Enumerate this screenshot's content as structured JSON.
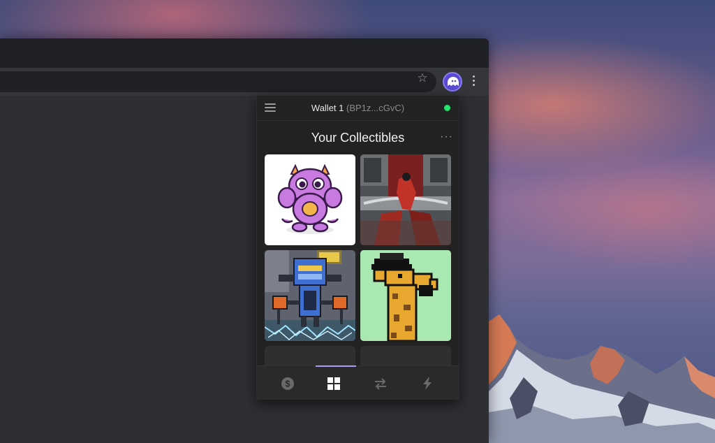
{
  "popup": {
    "wallet_name": "Wallet 1",
    "wallet_address": "(BP1z...cGvC)",
    "section_title": "Your Collectibles",
    "more_label": "···"
  },
  "collectibles": [
    {
      "name": "purple-monster-nft"
    },
    {
      "name": "red-warrior-nft"
    },
    {
      "name": "pixel-robot-nft"
    },
    {
      "name": "pixel-giraffe-nft"
    }
  ],
  "bottom_nav": {
    "items": [
      {
        "icon": "dollar-icon",
        "active": false
      },
      {
        "icon": "grid-icon",
        "active": true
      },
      {
        "icon": "swap-icon",
        "active": false
      },
      {
        "icon": "lightning-icon",
        "active": false
      }
    ]
  },
  "colors": {
    "status_connected": "#21e56f",
    "accent": "#ab9ff2",
    "extension_brand": "#5b4ad4"
  }
}
